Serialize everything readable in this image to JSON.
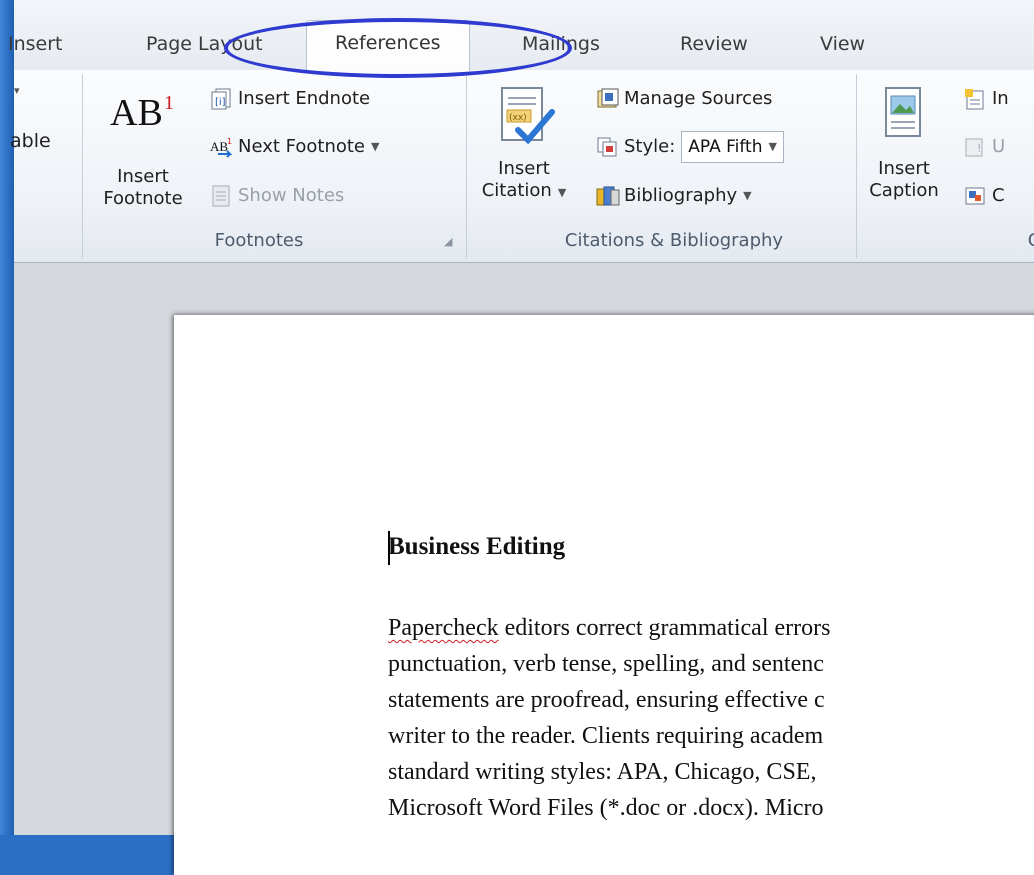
{
  "tabs": [
    "Insert",
    "Page Layout",
    "References",
    "Mailings",
    "Review",
    "View"
  ],
  "active_tab": "References",
  "ribbon": {
    "partial_left_label": "able",
    "footnotes": {
      "group_label": "Footnotes",
      "insert_footnote_line1": "Insert",
      "insert_footnote_line2": "Footnote",
      "insert_endnote": "Insert Endnote",
      "next_footnote": "Next Footnote",
      "show_notes": "Show Notes"
    },
    "citations": {
      "group_label": "Citations & Bibliography",
      "insert_citation_line1": "Insert",
      "insert_citation_line2": "Citation",
      "manage_sources": "Manage Sources",
      "style_label": "Style:",
      "style_value": "APA Fifth",
      "bibliography": "Bibliography"
    },
    "captions": {
      "insert_caption_line1": "Insert",
      "insert_caption_line2": "Caption",
      "item1_partial": "In",
      "item2_partial": "U",
      "item3_partial": "C",
      "group_label_partial": "C"
    }
  },
  "document": {
    "heading": "Business Editing",
    "lines": [
      {
        "first": "Papercheck",
        "rest": " editors correct grammatical errors"
      },
      {
        "first": "",
        "rest": "punctuation, verb tense, spelling, and sentenc"
      },
      {
        "first": "",
        "rest": "statements are proofread, ensuring effective c"
      },
      {
        "first": "",
        "rest": "writer to the reader. Clients requiring academ"
      },
      {
        "first": "",
        "rest": "standard writing styles: APA, Chicago, CSE,"
      },
      {
        "first": "",
        "rest": "Microsoft Word Files (*.doc or .docx). Micro"
      }
    ]
  },
  "colors": {
    "highlight_ellipse": "#2f3bd0",
    "ribbon_bg": "#eef2f7",
    "spell_error": "#d02020"
  }
}
